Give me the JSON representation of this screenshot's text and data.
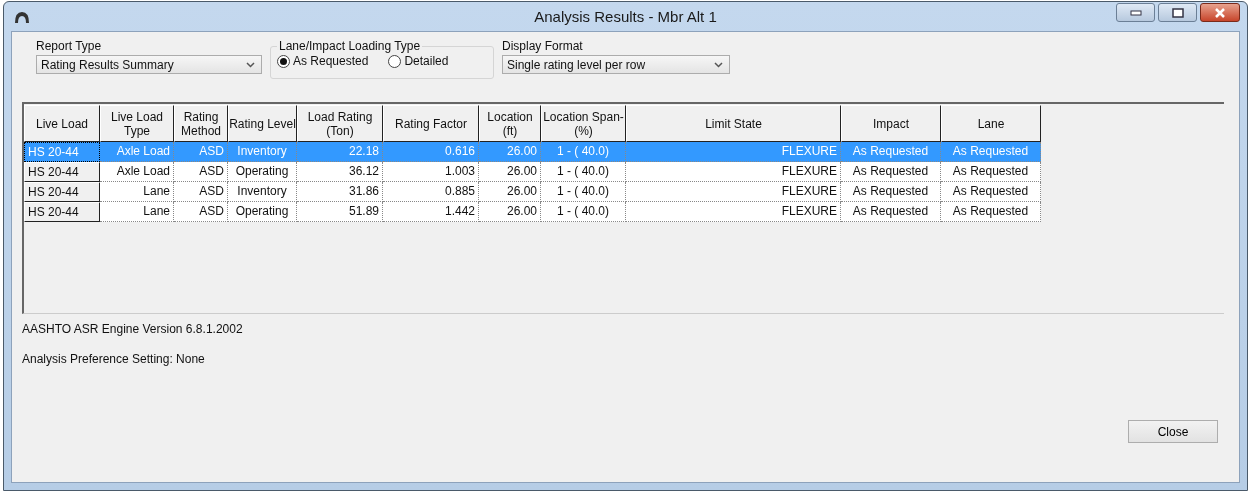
{
  "window": {
    "title": "Analysis Results - Mbr Alt 1"
  },
  "report_type": {
    "label": "Report Type",
    "value": "Rating Results Summary"
  },
  "loading_type": {
    "label": "Lane/Impact Loading Type",
    "options": [
      {
        "label": "As Requested",
        "selected": true
      },
      {
        "label": "Detailed",
        "selected": false
      }
    ]
  },
  "display_format": {
    "label": "Display Format",
    "value": "Single rating level per row"
  },
  "table": {
    "columns": [
      "Live Load",
      "Live Load Type",
      "Rating Method",
      "Rating Level",
      "Load Rating (Ton)",
      "Rating Factor",
      "Location (ft)",
      "Location Span-(%)",
      "Limit State",
      "Impact",
      "Lane"
    ],
    "rows": [
      {
        "selected": true,
        "cells": [
          "HS 20-44",
          "Axle Load",
          "ASD",
          "Inventory",
          "22.18",
          "0.616",
          "26.00",
          "1 - ( 40.0)",
          "FLEXURE",
          "As Requested",
          "As Requested"
        ]
      },
      {
        "selected": false,
        "cells": [
          "HS 20-44",
          "Axle Load",
          "ASD",
          "Operating",
          "36.12",
          "1.003",
          "26.00",
          "1 - ( 40.0)",
          "FLEXURE",
          "As Requested",
          "As Requested"
        ]
      },
      {
        "selected": false,
        "cells": [
          "HS 20-44",
          "Lane",
          "ASD",
          "Inventory",
          "31.86",
          "0.885",
          "26.00",
          "1 - ( 40.0)",
          "FLEXURE",
          "As Requested",
          "As Requested"
        ]
      },
      {
        "selected": false,
        "cells": [
          "HS 20-44",
          "Lane",
          "ASD",
          "Operating",
          "51.89",
          "1.442",
          "26.00",
          "1 - ( 40.0)",
          "FLEXURE",
          "As Requested",
          "As Requested"
        ]
      }
    ]
  },
  "engine_version": "AASHTO ASR Engine Version 6.8.1.2002",
  "preference_setting": "Analysis Preference Setting: None",
  "buttons": [
    "Close"
  ]
}
